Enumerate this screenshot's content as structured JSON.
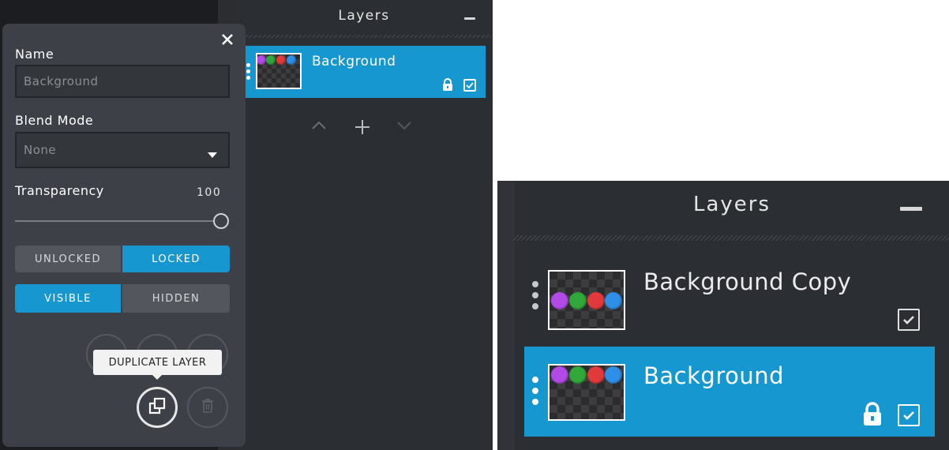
{
  "left": {
    "layers_panel": {
      "title": "Layers",
      "layers": [
        {
          "name": "Background",
          "selected": true,
          "locked": true,
          "visible": true
        }
      ],
      "controls": {
        "up": "^",
        "add": "+",
        "down": "v"
      }
    },
    "properties": {
      "name_label": "Name",
      "name_value": "Background",
      "blend_label": "Blend Mode",
      "blend_value": "None",
      "transparency_label": "Transparency",
      "transparency_value": "100",
      "transparency_level": 1.0,
      "lock_options": {
        "unlocked": "UNLOCKED",
        "locked": "LOCKED",
        "selected": "locked"
      },
      "visibility_options": {
        "visible": "VISIBLE",
        "hidden": "HIDDEN",
        "selected": "visible"
      },
      "tooltip": "DUPLICATE LAYER"
    }
  },
  "right": {
    "layers_panel": {
      "title": "Layers",
      "layers": [
        {
          "name": "Background Copy",
          "selected": false,
          "locked": false,
          "visible": true
        },
        {
          "name": "Background",
          "selected": true,
          "locked": true,
          "visible": true
        }
      ]
    }
  },
  "icons": [
    "close-icon",
    "minus-icon",
    "drag-handle-icon",
    "lock-icon",
    "checkbox-icon",
    "chevron-up-icon",
    "plus-icon",
    "chevron-down-icon",
    "dropdown-caret-icon",
    "duplicate-icon",
    "trash-icon"
  ],
  "colors": {
    "accent": "#1797cf",
    "panel": "#3d4147",
    "layers_bg": "#2b2e33",
    "ball_purple": "#b24be6",
    "ball_green": "#31a83a",
    "ball_red": "#e23a3a",
    "ball_blue": "#2f8ee6"
  }
}
